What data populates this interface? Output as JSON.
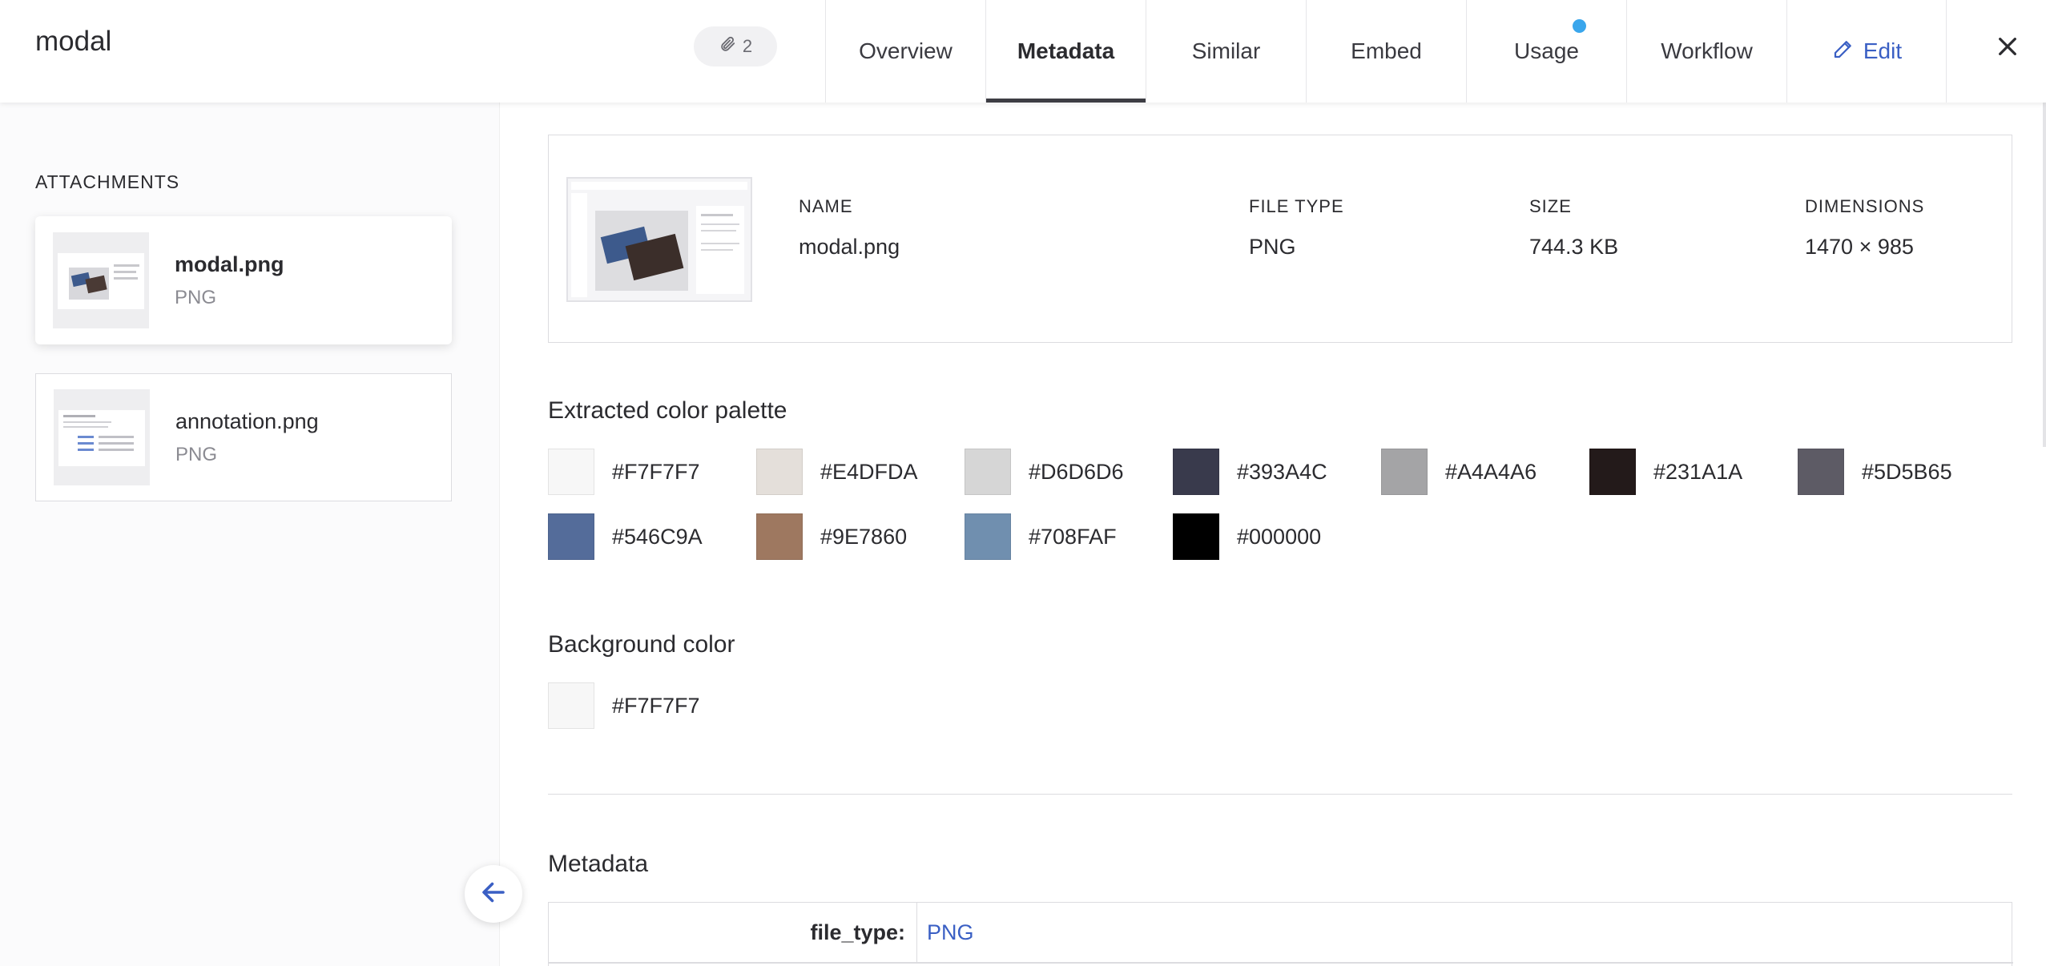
{
  "header": {
    "title": "modal",
    "attachment_count": "2",
    "tabs": [
      {
        "label": "Overview"
      },
      {
        "label": "Metadata"
      },
      {
        "label": "Similar"
      },
      {
        "label": "Embed"
      },
      {
        "label": "Usage"
      },
      {
        "label": "Workflow"
      },
      {
        "label": "Edit"
      }
    ],
    "active_tab": "Metadata"
  },
  "sidebar": {
    "heading": "ATTACHMENTS",
    "items": [
      {
        "name": "modal.png",
        "type": "PNG",
        "selected": true
      },
      {
        "name": "annotation.png",
        "type": "PNG",
        "selected": false
      }
    ]
  },
  "file_info": {
    "name_label": "NAME",
    "name_value": "modal.png",
    "type_label": "FILE TYPE",
    "type_value": "PNG",
    "size_label": "SIZE",
    "size_value": "744.3 KB",
    "dimensions_label": "DIMENSIONS",
    "dimensions_value": "1470 × 985"
  },
  "palette": {
    "title": "Extracted color palette",
    "colors": [
      "#F7F7F7",
      "#E4DFDA",
      "#D6D6D6",
      "#393A4C",
      "#A4A4A6",
      "#231A1A",
      "#5D5B65",
      "#546C9A",
      "#9E7860",
      "#708FAF",
      "#000000"
    ]
  },
  "background": {
    "title": "Background color",
    "color": "#F7F7F7"
  },
  "metadata": {
    "title": "Metadata",
    "rows": [
      {
        "key": "file_type:",
        "value": "PNG"
      }
    ]
  },
  "colors": {
    "accent": "#3a5fc4",
    "notification_dot": "#3aa6ec"
  }
}
